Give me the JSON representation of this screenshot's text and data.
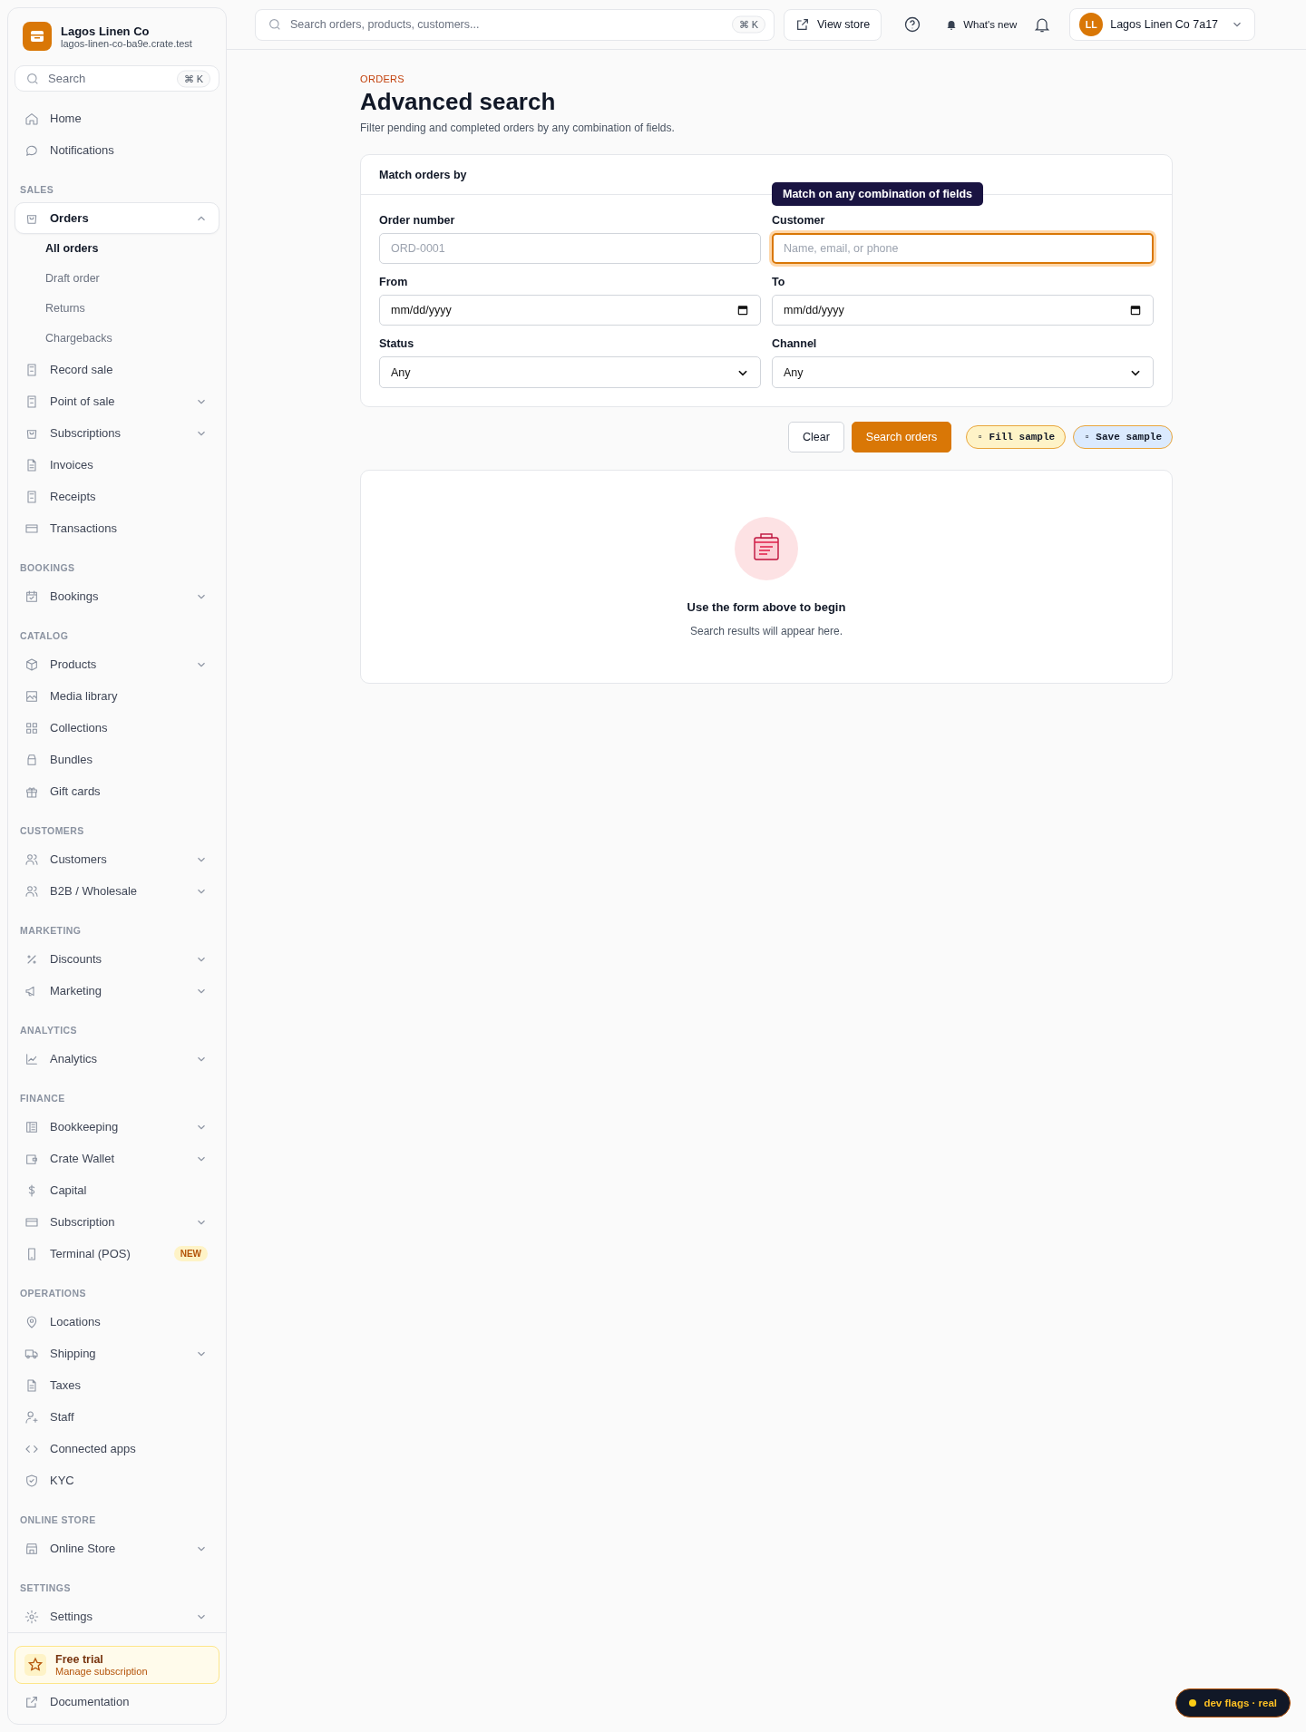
{
  "brand": {
    "name": "Lagos Linen Co",
    "domain": "lagos-linen-co-ba9e.crate.test"
  },
  "sidebar_search": {
    "placeholder": "Search",
    "shortcut": "⌘ K"
  },
  "sidebar": {
    "groups": [
      {
        "items": [
          {
            "label": "Home",
            "selected": false
          },
          {
            "label": "Notifications",
            "selected": false
          }
        ]
      },
      {
        "label": "SALES",
        "items": [
          {
            "label": "Orders",
            "selected": true,
            "expanded": true,
            "children": [
              {
                "label": "All orders",
                "selected": true
              },
              {
                "label": "Draft order",
                "selected": false
              },
              {
                "label": "Returns",
                "selected": false
              },
              {
                "label": "Chargebacks",
                "selected": false
              }
            ]
          },
          {
            "label": "Record sale",
            "selected": false
          },
          {
            "label": "Point of sale",
            "selected": false,
            "expanded": false
          },
          {
            "label": "Subscriptions",
            "selected": false,
            "expanded": false
          },
          {
            "label": "Invoices",
            "selected": false
          },
          {
            "label": "Receipts",
            "selected": false
          },
          {
            "label": "Transactions",
            "selected": false
          }
        ]
      },
      {
        "label": "BOOKINGS",
        "items": [
          {
            "label": "Bookings",
            "selected": false,
            "expanded": false
          }
        ]
      },
      {
        "label": "CATALOG",
        "items": [
          {
            "label": "Products",
            "selected": false,
            "expanded": false
          },
          {
            "label": "Media library",
            "selected": false
          },
          {
            "label": "Collections",
            "selected": false
          },
          {
            "label": "Bundles",
            "selected": false
          },
          {
            "label": "Gift cards",
            "selected": false
          }
        ]
      },
      {
        "label": "CUSTOMERS",
        "items": [
          {
            "label": "Customers",
            "selected": false,
            "expanded": false
          },
          {
            "label": "B2B / Wholesale",
            "selected": false,
            "expanded": false
          }
        ]
      },
      {
        "label": "MARKETING",
        "items": [
          {
            "label": "Discounts",
            "selected": false,
            "expanded": false
          },
          {
            "label": "Marketing",
            "selected": false,
            "expanded": false
          }
        ]
      },
      {
        "label": "ANALYTICS",
        "items": [
          {
            "label": "Analytics",
            "selected": false,
            "expanded": false
          }
        ]
      },
      {
        "label": "FINANCE",
        "items": [
          {
            "label": "Bookkeeping",
            "selected": false,
            "expanded": false
          },
          {
            "label": "Crate Wallet",
            "selected": false,
            "expanded": false
          },
          {
            "label": "Capital",
            "selected": false
          },
          {
            "label": "Subscription",
            "selected": false,
            "expanded": false
          },
          {
            "label": "Terminal (POS)",
            "selected": false,
            "badge": "NEW"
          }
        ]
      },
      {
        "label": "OPERATIONS",
        "items": [
          {
            "label": "Locations",
            "selected": false
          },
          {
            "label": "Shipping",
            "selected": false,
            "expanded": false
          },
          {
            "label": "Taxes",
            "selected": false
          },
          {
            "label": "Staff",
            "selected": false
          },
          {
            "label": "Connected apps",
            "selected": false
          },
          {
            "label": "KYC",
            "selected": false
          }
        ]
      },
      {
        "label": "ONLINE STORE",
        "items": [
          {
            "label": "Online Store",
            "selected": false,
            "expanded": false
          }
        ]
      },
      {
        "label": "SETTINGS",
        "items": [
          {
            "label": "Settings",
            "selected": false,
            "expanded": false
          }
        ]
      }
    ]
  },
  "trial": {
    "title": "Free trial",
    "subtitle": "Manage subscription"
  },
  "documentation": "Documentation",
  "topbar": {
    "search_placeholder": "Search orders, products, customers...",
    "shortcut": "⌘ K",
    "view_store": "View store",
    "whats_new": "What's new",
    "account": {
      "initials": "LL",
      "name": "Lagos Linen Co 7a17"
    }
  },
  "page": {
    "eyebrow": "ORDERS",
    "title": "Advanced search",
    "subtitle": "Filter pending and completed orders by any combination of fields."
  },
  "form": {
    "title": "Match orders by",
    "tooltip": "Match on any combination of fields",
    "fields": [
      {
        "kind": "text",
        "label": "Order number",
        "placeholder": "ORD-0001",
        "focused": false
      },
      {
        "kind": "text",
        "label": "Customer",
        "placeholder": "Name, email, or phone",
        "focused": true
      },
      {
        "kind": "date",
        "label": "From",
        "value": "mm/dd/yyyy"
      },
      {
        "kind": "date",
        "label": "To",
        "value": "mm/dd/yyyy"
      },
      {
        "kind": "select",
        "label": "Status",
        "value": "Any"
      },
      {
        "kind": "select",
        "label": "Channel",
        "value": "Any"
      }
    ]
  },
  "actions": [
    {
      "kind": "outline",
      "label": "Clear"
    },
    {
      "kind": "primary",
      "label": "Search orders"
    },
    {
      "kind": "sample",
      "label": "▫ Fill sample",
      "color": "#fef3c7"
    },
    {
      "kind": "sample",
      "label": "▫ Save sample",
      "color": "#dbeafe"
    }
  ],
  "empty": {
    "title": "Use the form above to begin",
    "text": "Search results will appear here."
  },
  "dev_flags": {
    "label": "dev flags · real"
  }
}
